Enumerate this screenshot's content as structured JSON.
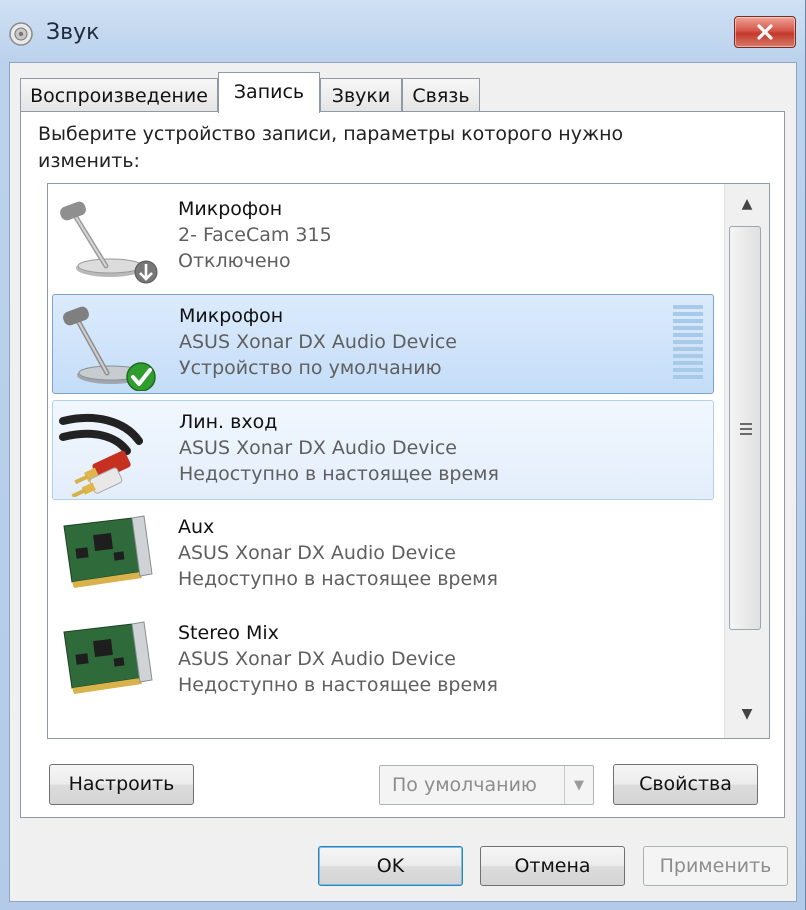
{
  "window": {
    "title": "Звук",
    "close_glyph": "✕"
  },
  "tabs": [
    {
      "label": "Воспроизведение",
      "active": false
    },
    {
      "label": "Запись",
      "active": true
    },
    {
      "label": "Звуки",
      "active": false
    },
    {
      "label": "Связь",
      "active": false
    }
  ],
  "instruction": "Выберите устройство записи, параметры которого нужно изменить:",
  "devices": [
    {
      "name": "Микрофон",
      "device": "2- FaceCam 315",
      "status": "Отключено",
      "icon": "microphone-disabled-icon"
    },
    {
      "name": "Микрофон",
      "device": "ASUS Xonar DX Audio Device",
      "status": "Устройство по умолчанию",
      "icon": "microphone-default-icon"
    },
    {
      "name": "Лин. вход",
      "device": "ASUS Xonar DX Audio Device",
      "status": "Недоступно в настоящее время",
      "icon": "line-in-cable-icon"
    },
    {
      "name": "Aux",
      "device": "ASUS Xonar DX Audio Device",
      "status": "Недоступно в настоящее время",
      "icon": "sound-card-icon"
    },
    {
      "name": "Stereo Mix",
      "device": "ASUS Xonar DX Audio Device",
      "status": "Недоступно в настоящее время",
      "icon": "sound-card-icon"
    }
  ],
  "buttons": {
    "configure": "Настроить",
    "default_dropdown": "По умолчанию",
    "properties": "Свойства",
    "ok": "OK",
    "cancel": "Отмена",
    "apply": "Применить"
  },
  "colors": {
    "selection": "#c4ddf8",
    "titlebar": "#bcd2ec",
    "close_button": "#c2392b",
    "check": "#2f9e2f"
  }
}
